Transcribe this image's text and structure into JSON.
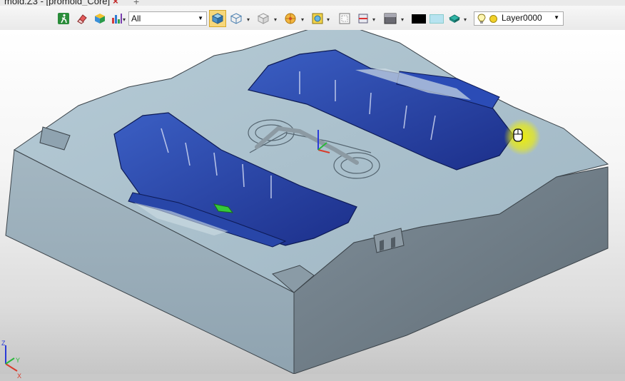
{
  "titlebar": {
    "tab_label": "mold.Z3 - [promold_Core]",
    "close_glyph": "×",
    "new_tab_glyph": "+"
  },
  "toolbar": {
    "filter": {
      "value": "All"
    },
    "layer": {
      "value": "Layer0000"
    },
    "icons": [
      "run-icon",
      "eraser-icon",
      "cube-color-icon",
      "chart-icon",
      "shaded-display-icon",
      "wireframe-display-icon",
      "hidden-line-icon",
      "render-mode-icon",
      "view-orient-icon",
      "frame-icon",
      "section-icon",
      "background-icon",
      "color-black-swatch",
      "color-lightblue-swatch",
      "material-icon",
      "light-bulb-icon"
    ],
    "colors": {
      "black": "#000000",
      "lightblue": "#b7e3f0",
      "accent": "#3a7bd5"
    }
  },
  "viewport": {
    "model": "mold core",
    "axes": {
      "x": "X",
      "y": "Y",
      "z": "Z"
    }
  }
}
